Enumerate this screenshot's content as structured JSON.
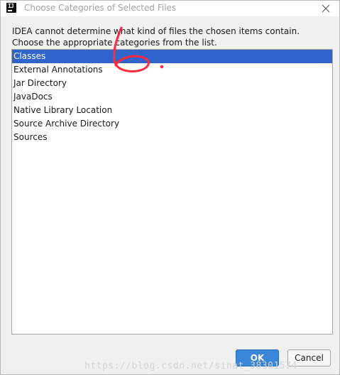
{
  "window": {
    "title": "Choose Categories of Selected Files",
    "app_icon": "intellij-idea-icon",
    "close_icon": "close-icon"
  },
  "description": {
    "line1": "IDEA cannot determine what kind of files the chosen items contain.",
    "line2": "Choose the appropriate categories from the list."
  },
  "categories": {
    "items": [
      {
        "label": "Classes",
        "selected": true
      },
      {
        "label": "External Annotations",
        "selected": false
      },
      {
        "label": "Jar Directory",
        "selected": false
      },
      {
        "label": "JavaDocs",
        "selected": false
      },
      {
        "label": "Native Library Location",
        "selected": false
      },
      {
        "label": "Source Archive Directory",
        "selected": false
      },
      {
        "label": "Sources",
        "selected": false
      }
    ]
  },
  "buttons": {
    "ok_label": "OK",
    "cancel_label": "Cancel"
  },
  "annotation": {
    "text": "6.",
    "color": "#ff2a3c"
  },
  "watermark": {
    "text": "https://blog.csdn.net/sinat_38301574"
  },
  "colors": {
    "selection": "#2f65ca",
    "ok_button": "#3a86d9"
  }
}
